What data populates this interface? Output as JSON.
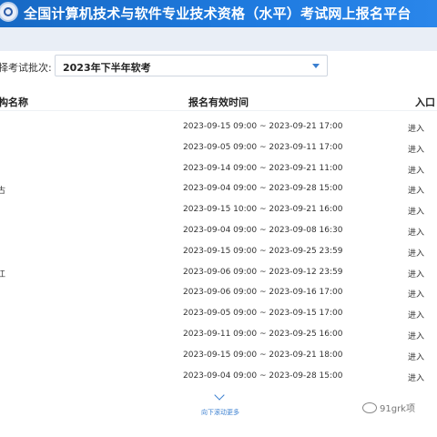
{
  "header": {
    "title": "全国计算机技术与软件专业技术资格（水平）考试网上报名平台"
  },
  "batch": {
    "label": "择考试批次:",
    "selected": "2023年下半年软考"
  },
  "table": {
    "columns": {
      "name": "构名称",
      "time": "报名有效时间",
      "entry": "入口"
    },
    "rows": [
      {
        "name": "",
        "time": "2023-09-15 09:00 ~ 2023-09-21 17:00",
        "entry": "进入"
      },
      {
        "name": "",
        "time": "2023-09-05 09:00 ~ 2023-09-11 17:00",
        "entry": "进入"
      },
      {
        "name": "",
        "time": "2023-09-14 09:00 ~ 2023-09-21 11:00",
        "entry": "进入"
      },
      {
        "name": "古",
        "time": "2023-09-04 09:00 ~ 2023-09-28 15:00",
        "entry": "进入"
      },
      {
        "name": "",
        "time": "2023-09-15 10:00 ~ 2023-09-21 16:00",
        "entry": "进入"
      },
      {
        "name": "",
        "time": "2023-09-04 09:00 ~ 2023-09-08 16:30",
        "entry": "进入"
      },
      {
        "name": "",
        "time": "2023-09-15 09:00 ~ 2023-09-25 23:59",
        "entry": "进入"
      },
      {
        "name": "江",
        "time": "2023-09-06 09:00 ~ 2023-09-12 23:59",
        "entry": "进入"
      },
      {
        "name": "",
        "time": "2023-09-06 09:00 ~ 2023-09-16 17:00",
        "entry": "进入"
      },
      {
        "name": "",
        "time": "2023-09-05 09:00 ~ 2023-09-15 17:00",
        "entry": "进入"
      },
      {
        "name": "",
        "time": "2023-09-11 09:00 ~ 2023-09-25 16:00",
        "entry": "进入"
      },
      {
        "name": "",
        "time": "2023-09-15 09:00 ~ 2023-09-21 18:00",
        "entry": "进入"
      },
      {
        "name": "",
        "time": "2023-09-04 09:00 ~ 2023-09-28 15:00",
        "entry": "进入"
      }
    ]
  },
  "scroll": {
    "more_label": "向下滚动更多"
  },
  "watermark": {
    "text": "91grk项"
  }
}
